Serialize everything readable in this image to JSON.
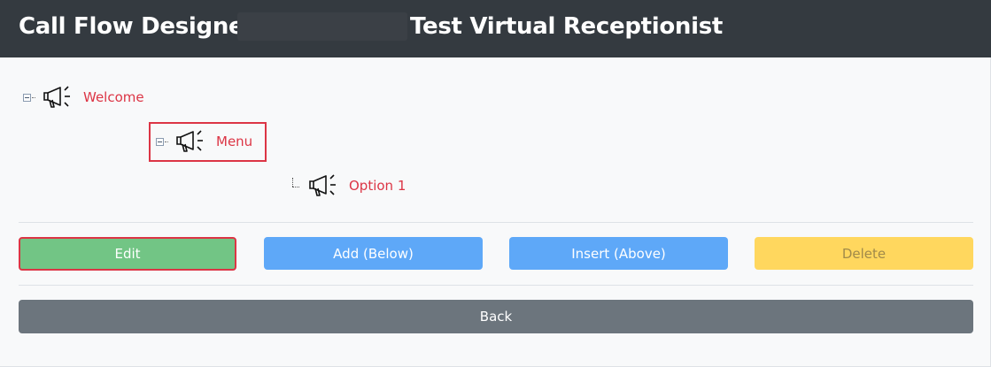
{
  "header": {
    "title": "Call Flow Designer:",
    "name": "Test Virtual Receptionist"
  },
  "tree": {
    "nodes": [
      {
        "label": "Welcome",
        "icon": "megaphone-icon",
        "expanded": true
      },
      {
        "label": "Menu",
        "icon": "megaphone-icon",
        "expanded": true,
        "selected": true
      },
      {
        "label": "Option 1",
        "icon": "megaphone-icon",
        "expanded": false
      }
    ]
  },
  "actions": {
    "edit": "Edit",
    "add": "Add (Below)",
    "insert": "Insert (Above)",
    "delete": "Delete",
    "back": "Back"
  },
  "colors": {
    "header_bg": "#343a40",
    "node_label": "#dc3545",
    "edit": "#72c585",
    "add": "#5ea8f8",
    "insert": "#5ea8f8",
    "delete": "#ffd75e",
    "back": "#6c757d",
    "highlight": "#dc3545"
  }
}
